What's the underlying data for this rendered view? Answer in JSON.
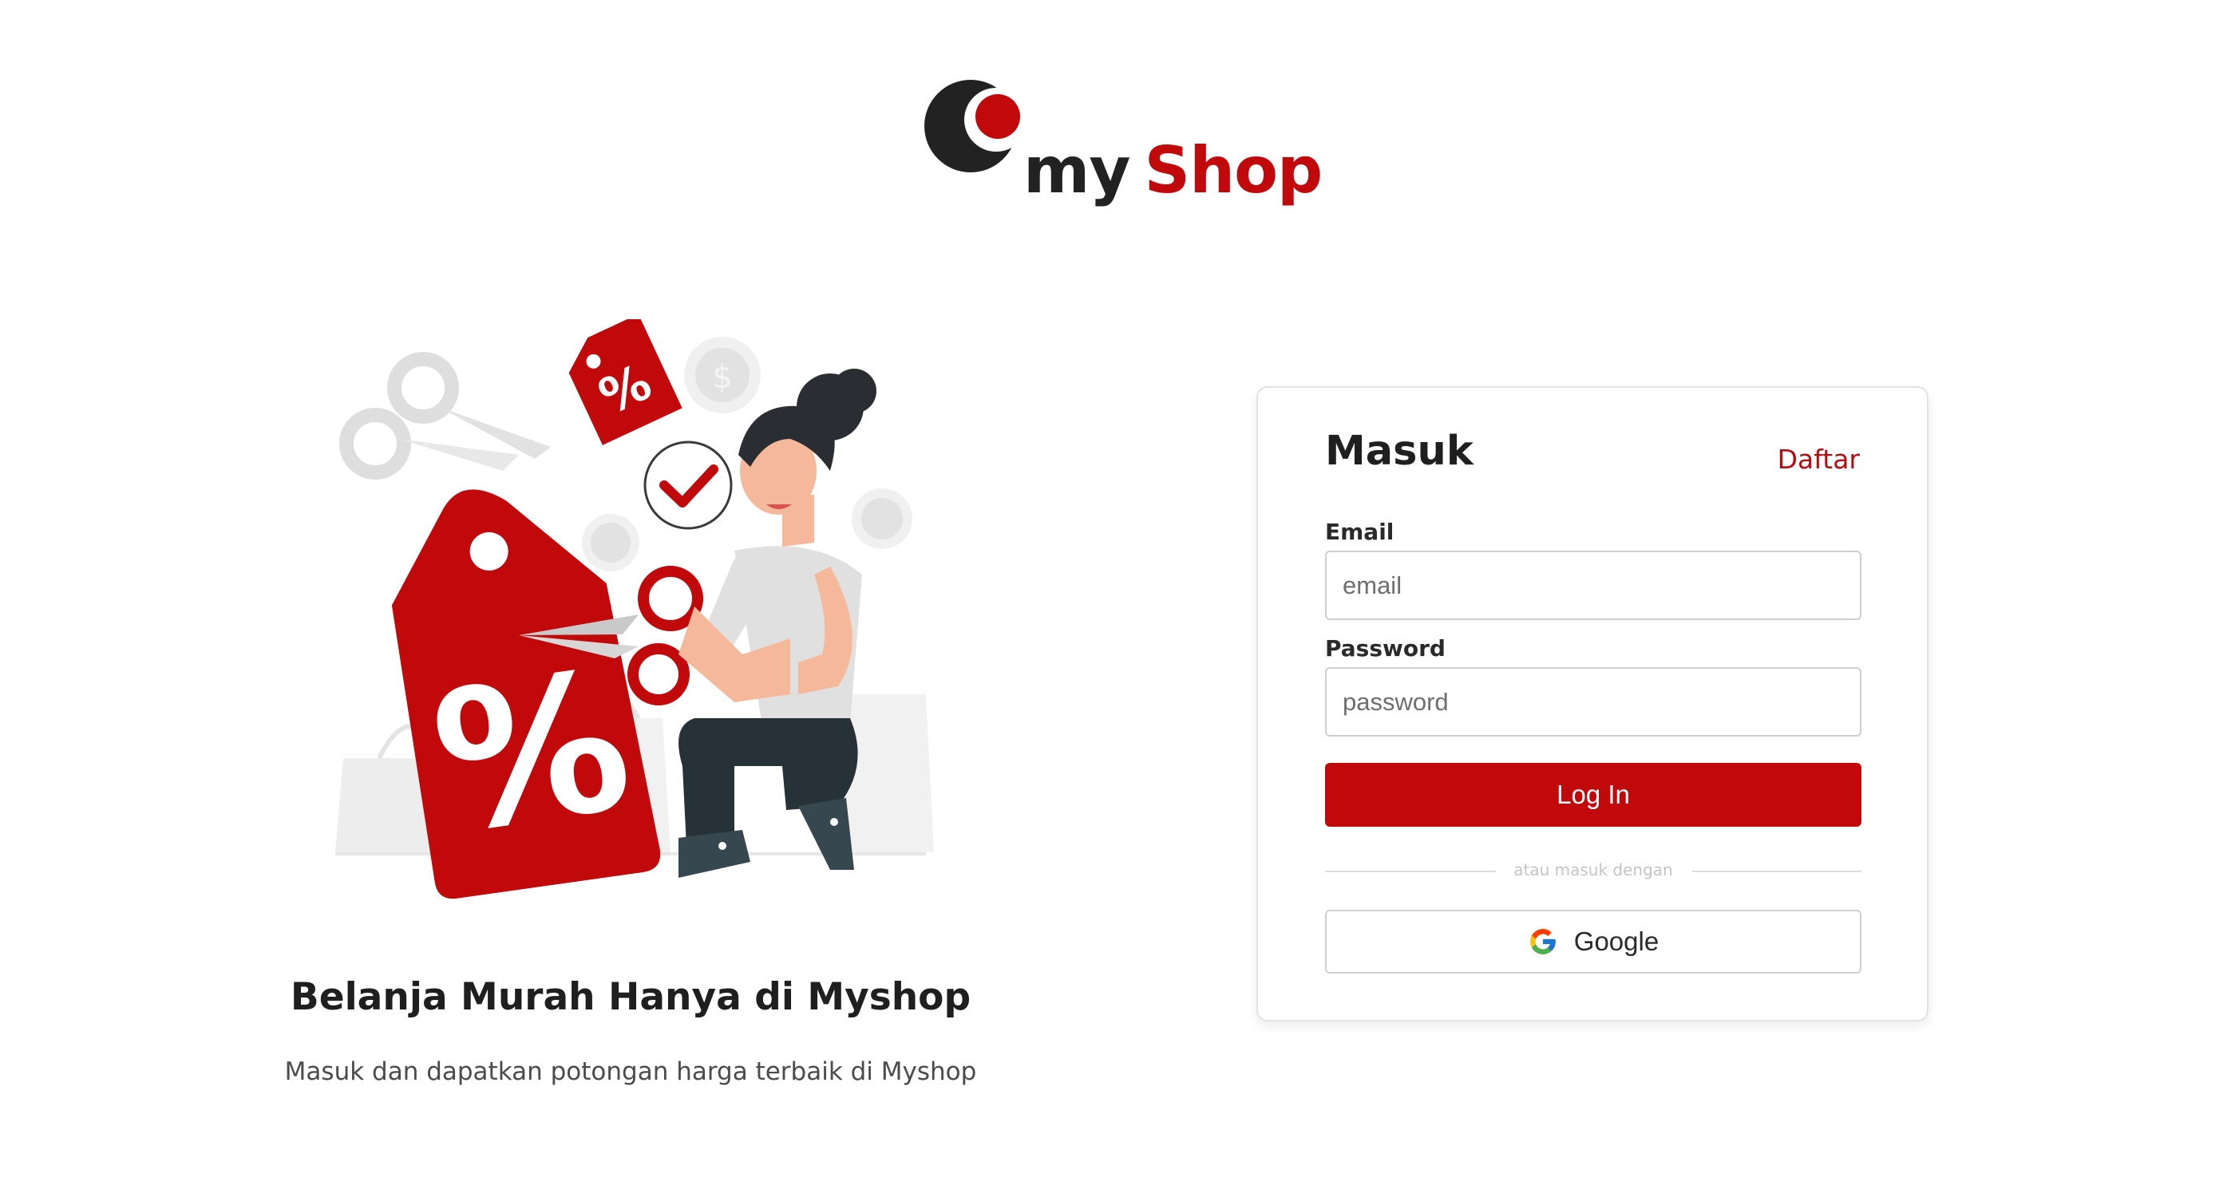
{
  "brand": {
    "name_part1": "my",
    "name_part2": "Shop",
    "colors": {
      "primary": "#c1080b",
      "dark": "#222222"
    }
  },
  "hero": {
    "title": "Belanja Murah Hanya di Myshop",
    "subtitle": "Masuk dan dapatkan potongan harga terbaik di Myshop",
    "illustration": "woman-cutting-discount-tag-illustration"
  },
  "login_card": {
    "title": "Masuk",
    "register_link": "Daftar",
    "email": {
      "label": "Email",
      "placeholder": "email",
      "value": ""
    },
    "password": {
      "label": "Password",
      "placeholder": "password",
      "value": ""
    },
    "submit_label": "Log In",
    "divider_text": "atau masuk dengan",
    "google_label": "Google",
    "google_icon": "google-icon"
  }
}
